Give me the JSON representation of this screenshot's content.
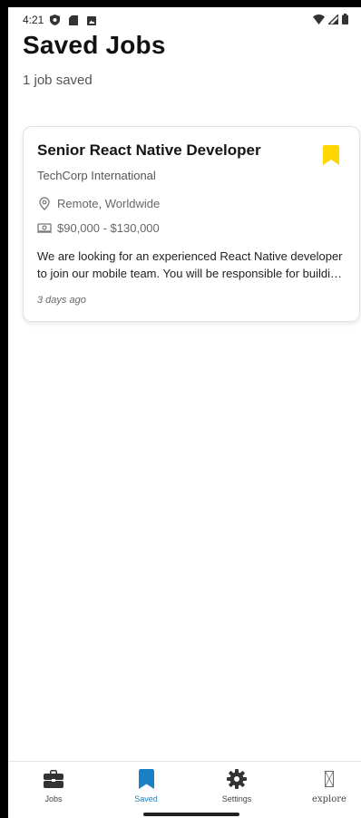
{
  "status_bar": {
    "time": "4:21",
    "left_icons": [
      "shield-icon",
      "sd-card-icon",
      "image-icon"
    ],
    "right_icons": [
      "wifi-icon",
      "signal-icon",
      "battery-icon"
    ]
  },
  "header": {
    "title": "Saved Jobs",
    "subtitle": "1 job saved"
  },
  "jobs": [
    {
      "title": "Senior React Native Developer",
      "company": "TechCorp International",
      "location": "Remote, Worldwide",
      "salary": "$90,000 - $130,000",
      "description": "We are looking for an experienced React Native developer to join our mobile team. You will be responsible for building and maintaining our apps.",
      "posted": "3 days ago",
      "bookmarked": true,
      "bookmark_color": "#FFD600"
    }
  ],
  "bottom_nav": {
    "items": [
      {
        "label": "Jobs",
        "icon": "briefcase-icon",
        "active": false
      },
      {
        "label": "Saved",
        "icon": "bookmark-icon",
        "active": true
      },
      {
        "label": "Settings",
        "icon": "gear-icon",
        "active": false
      },
      {
        "label": "explore",
        "icon": "missing-glyph-icon",
        "active": false
      }
    ],
    "active_color": "#1a7fc4",
    "inactive_color": "#444444"
  }
}
